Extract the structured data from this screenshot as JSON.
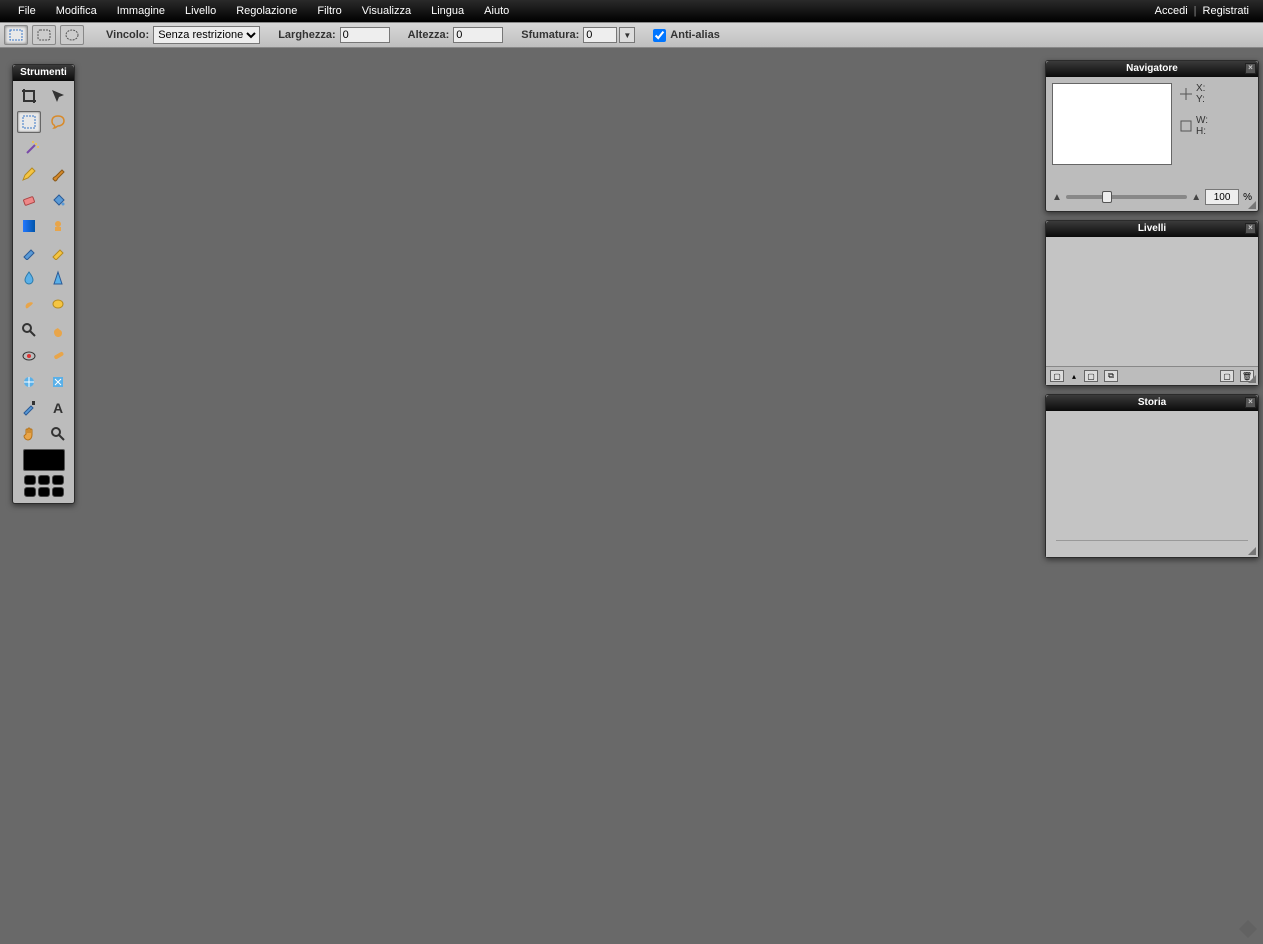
{
  "menu": {
    "items": [
      "File",
      "Modifica",
      "Immagine",
      "Livello",
      "Regolazione",
      "Filtro",
      "Visualizza",
      "Lingua",
      "Aiuto"
    ],
    "right": {
      "login": "Accedi",
      "register": "Registrati"
    }
  },
  "options": {
    "constraint_label": "Vincolo:",
    "constraint_value": "Senza restrizione",
    "width_label": "Larghezza:",
    "width_value": "0",
    "height_label": "Altezza:",
    "height_value": "0",
    "feather_label": "Sfumatura:",
    "feather_value": "0",
    "antialias_label": "Anti-alias",
    "antialias_checked": true
  },
  "panels": {
    "tools_title": "Strumenti",
    "navigator_title": "Navigatore",
    "layers_title": "Livelli",
    "history_title": "Storia"
  },
  "navigator": {
    "x_label": "X:",
    "y_label": "Y:",
    "w_label": "W:",
    "h_label": "H:",
    "zoom_value": "100",
    "zoom_unit": "%"
  },
  "tools": {
    "names": [
      [
        "crop",
        "move"
      ],
      [
        "marquee",
        "lasso"
      ],
      [
        "wand"
      ],
      [
        "pencil",
        "brush"
      ],
      [
        "eraser",
        "paint-bucket"
      ],
      [
        "gradient",
        "clone-stamp"
      ],
      [
        "color-replace",
        "sponge"
      ],
      [
        "blur",
        "sharpen"
      ],
      [
        "smudge",
        "dodge"
      ],
      [
        "zoom",
        "hand-alt"
      ],
      [
        "red-eye",
        "heal"
      ],
      [
        "bloat",
        "pinch"
      ],
      [
        "eyedropper",
        "type"
      ],
      [
        "hand",
        "zoom-tool"
      ]
    ]
  },
  "colors": {
    "foreground": "#000000"
  }
}
